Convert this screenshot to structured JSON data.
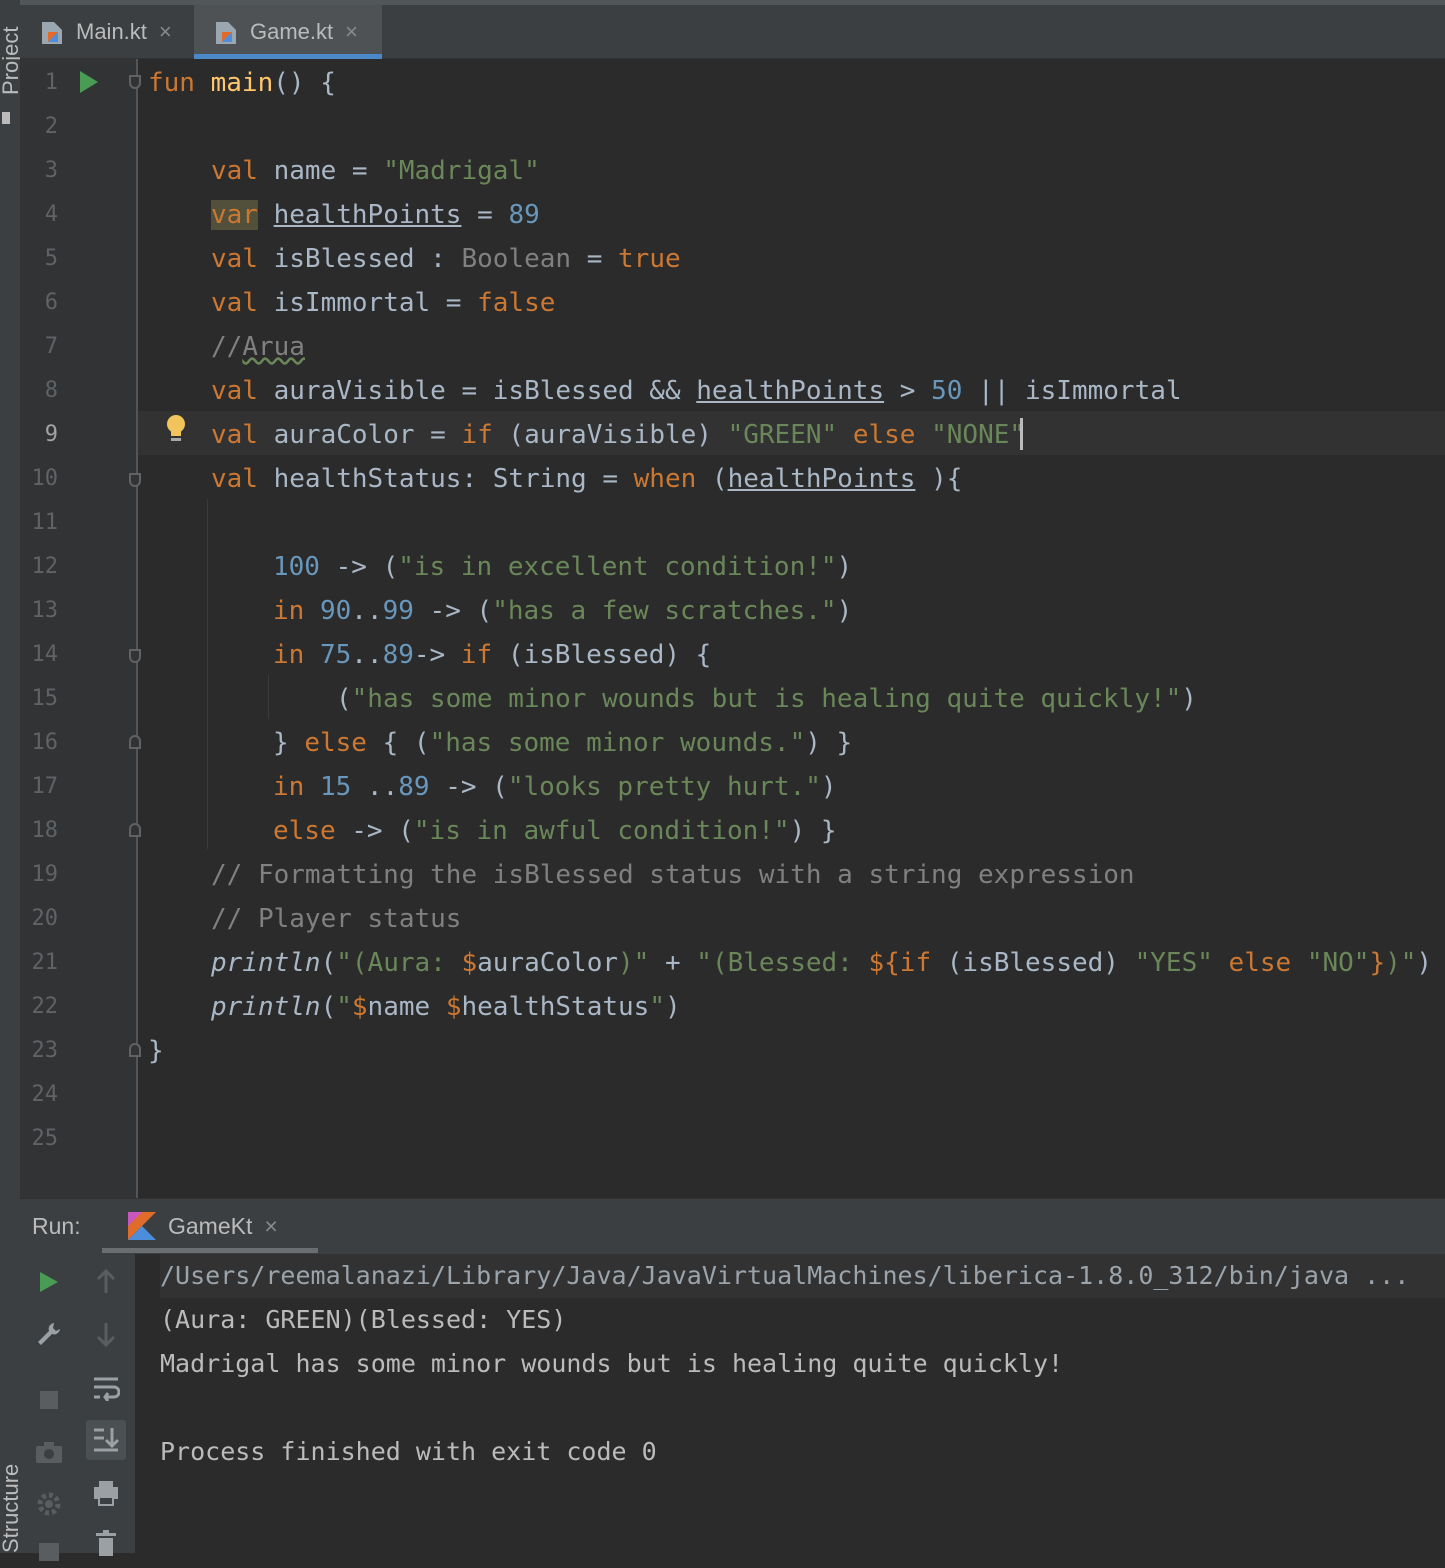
{
  "side_labels": {
    "project": "Project",
    "structure": "Structure"
  },
  "tabs": [
    {
      "label": "Main.kt",
      "close": "×"
    },
    {
      "label": "Game.kt",
      "close": "×"
    }
  ],
  "editor": {
    "line_numbers": [
      "1",
      "2",
      "3",
      "4",
      "5",
      "6",
      "7",
      "8",
      "9",
      "10",
      "11",
      "12",
      "13",
      "14",
      "15",
      "16",
      "17",
      "18",
      "19",
      "20",
      "21",
      "22",
      "23",
      "24",
      "25"
    ],
    "code": {
      "l1": {
        "fun": "fun",
        "main": "main",
        "rest": "() {"
      },
      "l3": {
        "val": "val",
        "name": " name = ",
        "str": "\"Madrigal\""
      },
      "l4": {
        "var": "var",
        "sp": " ",
        "hp": "healthPoints",
        "eq": " = ",
        "num": "89"
      },
      "l5": {
        "val": "val",
        "name": " isBlessed : ",
        "type": "Boolean",
        "eq": " = ",
        "val2": "true"
      },
      "l6": {
        "val": "val",
        "name": " isImmortal = ",
        "val2": "false"
      },
      "l7": {
        "slashes": "//",
        "word": "Arua"
      },
      "l8": {
        "val": "val",
        "a": " auraVisible = isBlessed && ",
        "hp": "healthPoints",
        "b": " > ",
        "num": "50",
        "c": " || isImmortal"
      },
      "l9": {
        "val": "val",
        "a": " auraColor = ",
        "if": "if",
        "b": " (auraVisible) ",
        "s1": "\"GREEN\"",
        "sp": " ",
        "else": "else",
        "sp2": " ",
        "s2": "\"NONE\""
      },
      "l10": {
        "val": "val",
        "a": " healthStatus: String = ",
        "when": "when",
        "b": " (",
        "hp": "healthPoints",
        "c": " ){"
      },
      "l12": {
        "num": "100",
        "a": " -> (",
        "str": "\"is in excellent condition!\"",
        "b": ")"
      },
      "l13": {
        "in": "in",
        "sp": " ",
        "n1": "90",
        "dd": "..",
        "n2": "99",
        "a": " -> (",
        "str": "\"has a few scratches.\"",
        "b": ")"
      },
      "l14": {
        "in": "in",
        "sp": " ",
        "n1": "75",
        "dd": "..",
        "n2": "89",
        "a": "-> ",
        "if": "if",
        "b": " (isBlessed) {"
      },
      "l15": {
        "a": "(",
        "str": "\"has some minor wounds but is healing quite quickly!\"",
        "b": ")"
      },
      "l16": {
        "a": "} ",
        "else": "else",
        "b": " { (",
        "str": "\"has some minor wounds.\"",
        "c": ") }"
      },
      "l17": {
        "in": "in",
        "sp": " ",
        "n1": "15",
        "dd": " ..",
        "n2": "89",
        "a": " -> (",
        "str": "\"looks pretty hurt.\"",
        "b": ")"
      },
      "l18": {
        "else": "else",
        "a": " -> (",
        "str": "\"is in awful condition!\"",
        "b": ") }"
      },
      "l19": {
        "cm": "// Formatting the isBlessed status with a string expression"
      },
      "l20": {
        "cm": "// Player status"
      },
      "l21": {
        "fn": "println",
        "a": "(",
        "s1": "\"(Aura: ",
        "t1": "$",
        "v1": "auraColor",
        "s2": ")\"",
        "b": " + ",
        "s3": "\"(Blessed: ",
        "t2": "${",
        "if": "if",
        "c": " (isBlessed) ",
        "s4": "\"YES\"",
        "sp": " ",
        "else": "else",
        "sp2": " ",
        "s5": "\"NO\"",
        "t3": "}",
        "s6": ")\"",
        "d": ")"
      },
      "l22": {
        "fn": "println",
        "a": "(",
        "s1": "\"",
        "t1": "$",
        "v1": "name",
        "sp": " ",
        "t2": "$",
        "v2": "healthStatus",
        "s2": "\"",
        "b": ")"
      },
      "l23": {
        "a": "}"
      }
    }
  },
  "run_panel": {
    "label": "Run:",
    "tab_label": "GameKt",
    "tab_close": "×",
    "console": [
      "/Users/reemalanazi/Library/Java/JavaVirtualMachines/liberica-1.8.0_312/bin/java ...",
      "(Aura: GREEN)(Blessed: YES)",
      "Madrigal has some minor wounds but is healing quite quickly!",
      "",
      "Process finished with exit code 0"
    ]
  },
  "colors": {
    "keyword": "#cc7832",
    "string": "#6a8759",
    "number": "#6897bb",
    "function": "#ffc66d",
    "comment": "#808080",
    "text": "#a9b7c6",
    "background": "#2b2b2b",
    "accent": "#4a88c7"
  },
  "icons": {
    "file_tab": "kotlin-file-icon",
    "run_gutter": "run-triangle-icon",
    "intention": "lightbulb-icon",
    "toolbar": [
      "rerun-icon",
      "wrench-icon",
      "stop-icon",
      "camera-icon",
      "settings-icon",
      "up-arrow-icon",
      "down-arrow-icon",
      "soft-wrap-icon",
      "scroll-to-end-icon",
      "print-icon",
      "trash-icon"
    ]
  }
}
